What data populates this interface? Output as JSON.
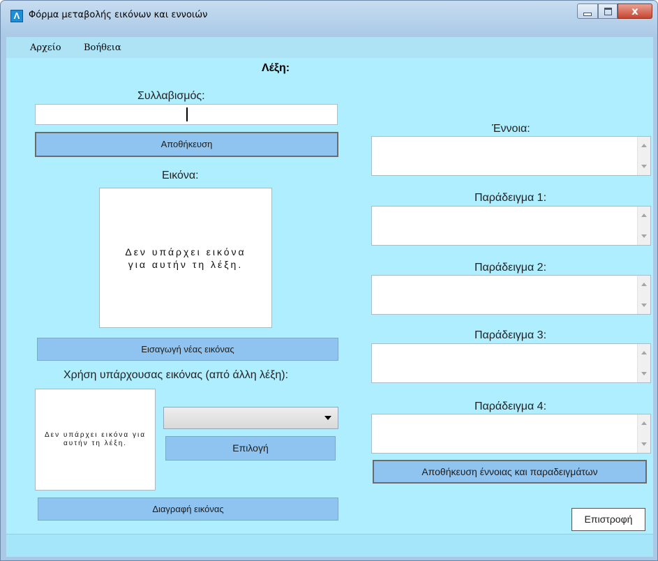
{
  "window": {
    "title": "Φόρμα μεταβολής εικόνων και εννοιών",
    "app_icon_glyph": "Λ",
    "controls": {
      "minimize_icon": "minimize-icon",
      "maximize_icon": "maximize-icon",
      "close_icon": "close-icon",
      "close_glyph": "x"
    }
  },
  "menu": {
    "items": [
      {
        "label": "Αρχείο"
      },
      {
        "label": "Βοήθεια"
      }
    ]
  },
  "word_section": {
    "word_label": "Λέξη:",
    "syllabification_label": "Συλλαβισμός:",
    "syllabification_value": "",
    "save_button": "Αποθήκευση"
  },
  "image_section": {
    "image_label": "Εικόνα:",
    "no_image_text": "Δεν υπάρχει εικόνα για αυτήν τη λέξη.",
    "insert_button": "Εισαγωγή νέας εικόνας",
    "existing_label": "Χρήση υπάρχουσας εικόνας (από άλλη λέξη):",
    "existing_no_image_text": "Δεν υπάρχει εικόνα για αυτήν τη λέξη.",
    "existing_select_value": "",
    "select_button": "Επιλογή",
    "delete_button": "Διαγραφή εικόνας"
  },
  "concept_section": {
    "concept_label": "Έννοια:",
    "concept_value": "",
    "example1_label": "Παράδειγμα 1:",
    "example2_label": "Παράδειγμα 2:",
    "example3_label": "Παράδειγμα 3:",
    "example4_label": "Παράδειγμα 4:",
    "save_button": "Αποθήκευση έννοιας και παραδειγμάτων",
    "return_button": "Επιστροφή"
  },
  "colors": {
    "client_background": "#aeeeff",
    "button_fill": "#8fc4f0",
    "menubar": "#ade3f5"
  }
}
